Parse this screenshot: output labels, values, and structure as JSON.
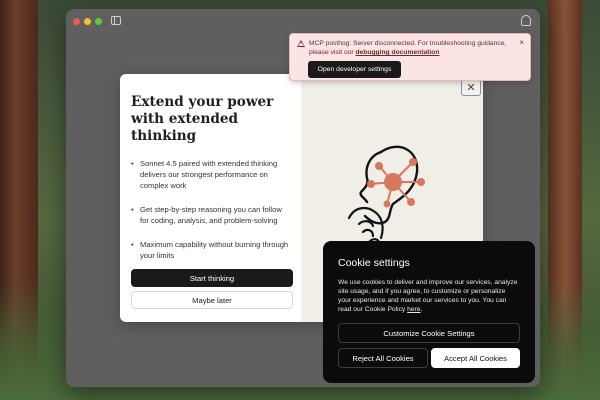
{
  "notification": {
    "text": "MCP posthog: Server disconnected. For troubleshooting guidance, please visit our ",
    "link": "debugging documentation",
    "button": "Open developer settings",
    "close_symbol": "×",
    "icon": "warning-icon"
  },
  "modal": {
    "title": "Extend your power with extended thinking",
    "bullets": [
      "Sonnet 4.5 paired with extended thinking delivers our strongest performance on complex work",
      "Get step-by-step reasoning you can follow for coding, analysis, and problem-solving",
      "Maximum capability without burning through your limits"
    ],
    "primary_button": "Start thinking",
    "secondary_button": "Maybe later",
    "close_symbol": "✕",
    "illustration_accent": "#d9775e"
  },
  "cookie": {
    "title": "Cookie settings",
    "body": "We use cookies to deliver and improve our services, analyze site usage, and if you agree, to customize or personalize your experience and market our services to you. You can read our Cookie Policy ",
    "link": "here",
    "body_end": ".",
    "customize_button": "Customize Cookie Settings",
    "reject_button": "Reject All Cookies",
    "accept_button": "Accept All Cookies"
  }
}
